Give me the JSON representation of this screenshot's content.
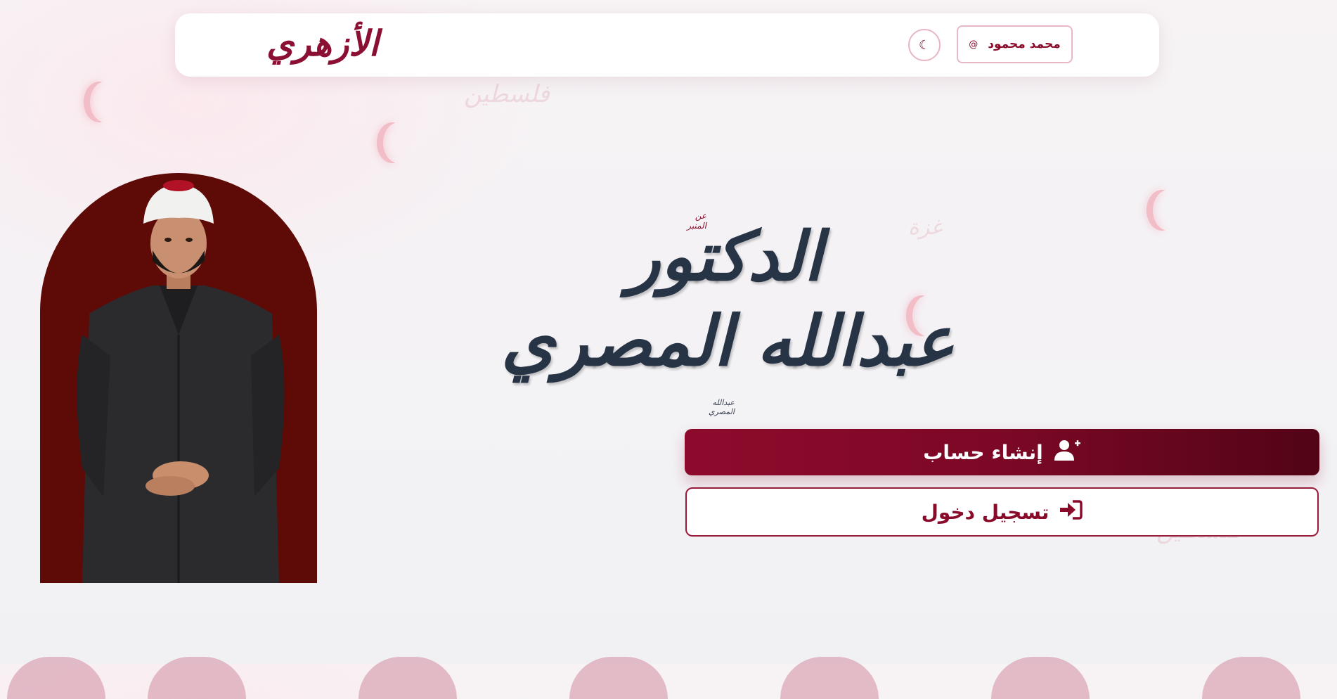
{
  "header": {
    "logo_text": "الأزهري",
    "user_name": "محمد محمود",
    "user_at": "@",
    "theme_icon": "☾"
  },
  "hero": {
    "eyebrow": "عن المنبر",
    "title_line1": "الدكتور",
    "title_line2": "عبدالله المصري",
    "signature": "عبدالله المصري"
  },
  "actions": {
    "register_label": "إنشاء حساب",
    "login_label": "تسجيل دخول"
  },
  "decorations": {
    "words": [
      "فلسطين",
      "غزة",
      "فلسطين"
    ]
  },
  "colors": {
    "accent": "#8a0a2a",
    "accent_dark": "#520416",
    "portrait_bg": "#5e0a06",
    "text_dark": "#273446"
  },
  "icons": {
    "register": "user-plus-icon",
    "login": "sign-in-icon",
    "theme": "moon-icon"
  }
}
